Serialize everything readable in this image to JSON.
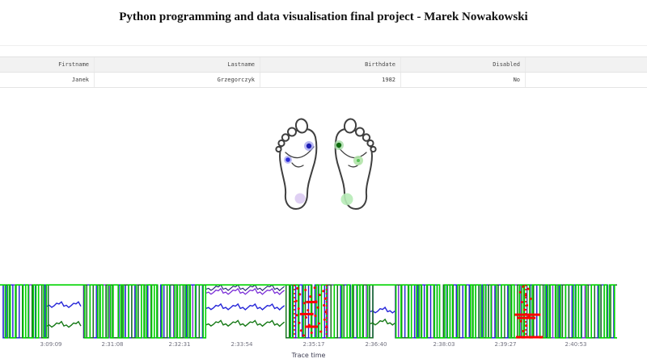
{
  "page": {
    "title": "Python programming and data visualisation final project - Marek Nowakowski"
  },
  "patient_table": {
    "columns": [
      {
        "label": "Firstname"
      },
      {
        "label": "Lastname"
      },
      {
        "label": "Birthdate"
      },
      {
        "label": "Disabled"
      }
    ],
    "rows": [
      {
        "firstname": "Janek",
        "lastname": "Grzegorczyk",
        "birthdate": "1982",
        "disabled": "No"
      }
    ]
  },
  "feet": {
    "sensors": [
      {
        "name": "left-ball-inner",
        "halo": "#9a9aec",
        "core": "#1c1cb4"
      },
      {
        "name": "left-ball-outer",
        "halo": "#9a9aec",
        "core": "#2d2dd9"
      },
      {
        "name": "left-heel",
        "halo": "#d9c8f1",
        "core": ""
      },
      {
        "name": "right-ball-inner",
        "halo": "#a6dba6",
        "core": "#0d6b0d"
      },
      {
        "name": "right-ball-outer",
        "halo": "#b2e4aa",
        "core": "#57c057"
      },
      {
        "name": "right-heel",
        "halo": "#b7ebb7",
        "core": ""
      }
    ]
  },
  "chart_data": {
    "type": "line",
    "title": "",
    "xlabel": "Trace time",
    "ylabel": "",
    "grid": false,
    "legend": "none",
    "y_range": [
      0,
      1
    ],
    "x_tick_labels": [
      "3:09:09",
      "2:31:08",
      "2:32:31",
      "2:33:54",
      "2:35:17",
      "2:36:40",
      "2:38:03",
      "2:39:27",
      "2:40:53"
    ],
    "x_tick_positions": [
      0.083,
      0.182,
      0.291,
      0.392,
      0.509,
      0.609,
      0.72,
      0.819,
      0.933
    ],
    "series": [
      {
        "name": "sensor-trace-navy",
        "color": "#1c1c6e",
        "width": 1.1,
        "bits": [
          "1000100100001001",
          "0000100100001001",
          "0010000100100001",
          "0000100100001001",
          "1000100100001001",
          "0010000100100001",
          "0000100100001001",
          "1000100100001001",
          "0000100100001001",
          "0010000100100001",
          "1000100100001001",
          "0000100100001001"
        ],
        "flat_top_ranges": [
          [
            0.076,
            0.131
          ],
          [
            0.334,
            0.461
          ],
          [
            0.6,
            0.64
          ]
        ],
        "analog": [
          {
            "x0": 0.334,
            "x1": 0.461,
            "y": 0.07
          }
        ]
      },
      {
        "name": "sensor-trace-violet",
        "color": "#7c2fd8",
        "width": 1.3,
        "bits": [
          "1001101001010011",
          "0100101001101001",
          "1010010100110100",
          "1001101001010011",
          "1010010100110100",
          "0100101001101001",
          "1001101001010011",
          "0100101001101001",
          "1010010100110100",
          "1001101001010011",
          "1010010100110100",
          "0100101001101001"
        ],
        "flat_top_ranges": [
          [
            0.076,
            0.131
          ],
          [
            0.334,
            0.461
          ],
          [
            0.6,
            0.64
          ]
        ],
        "analog": [
          {
            "x0": 0.334,
            "x1": 0.461,
            "y": 0.14
          }
        ]
      },
      {
        "name": "sensor-trace-blue",
        "color": "#2424d8",
        "width": 1.4,
        "bits": [
          "1011001100101100",
          "1100101100110010",
          "0110011001011010",
          "1010011001011001",
          "1100101100110010",
          "1011001100101100",
          "1010011001011001",
          "0110011001011010",
          "1011001100101100",
          "1100101100110010",
          "0110011001011010",
          "1010011001011001"
        ],
        "flat_top_ranges": [
          [
            0.076,
            0.131
          ],
          [
            0.334,
            0.461
          ],
          [
            0.6,
            0.64
          ]
        ],
        "analog": [
          {
            "x0": 0.076,
            "x1": 0.131,
            "y": 0.38
          },
          {
            "x0": 0.334,
            "x1": 0.461,
            "y": 0.42
          },
          {
            "x0": 0.6,
            "x1": 0.64,
            "y": 0.48
          }
        ]
      },
      {
        "name": "sensor-trace-darkgreen",
        "color": "#147814",
        "width": 1.4,
        "bits": [
          "1110011000111001",
          "1001100011100110",
          "0110001110011001",
          "1000111001100011",
          "1001100011100110",
          "1110011000111001",
          "1000111001100011",
          "0110001110011001",
          "1110011000111001",
          "1001100011100110",
          "0110001110011001",
          "1000111001100011"
        ],
        "flat_top_ranges": [
          [
            0.076,
            0.131
          ],
          [
            0.334,
            0.461
          ],
          [
            0.6,
            0.64
          ]
        ],
        "analog": [
          {
            "x0": 0.076,
            "x1": 0.131,
            "y": 0.74
          },
          {
            "x0": 0.334,
            "x1": 0.461,
            "y": 0.72
          },
          {
            "x0": 0.6,
            "x1": 0.64,
            "y": 0.7
          }
        ]
      },
      {
        "name": "sensor-trace-lime",
        "color": "#00d400",
        "width": 1.6,
        "bits": [
          "1101001110100101",
          "1011001110010110",
          "1001110100101101",
          "0011100101101001",
          "1100101101001110",
          "1101001110100101",
          "1001110100101101",
          "1011001110010110",
          "0011100101101001",
          "1100101101001110",
          "1101001110100101",
          "0011100101101001",
          "1001110100101101",
          "1100101101001110",
          "1011001110010110"
        ],
        "flat_top_ranges": [
          [
            0.076,
            0.131
          ],
          [
            0.334,
            0.461
          ],
          [
            0.6,
            0.64
          ]
        ]
      }
    ],
    "annotations": [
      {
        "name": "red-selection-box",
        "color": "#ff0000",
        "style": "dotted",
        "x0": 0.477,
        "x1": 0.529,
        "bars": [
          [
            0.33,
            0.496,
            0.514
          ],
          [
            0.55,
            0.486,
            0.508
          ],
          [
            0.78,
            0.494,
            0.515
          ]
        ],
        "dots": [
          [
            0.482,
            0.08
          ],
          [
            0.495,
            0.11
          ],
          [
            0.51,
            0.07
          ],
          [
            0.524,
            0.13
          ],
          [
            0.486,
            0.19
          ],
          [
            0.503,
            0.23
          ],
          [
            0.518,
            0.2
          ],
          [
            0.527,
            0.27
          ],
          [
            0.48,
            0.31
          ],
          [
            0.493,
            0.35
          ],
          [
            0.512,
            0.32
          ],
          [
            0.525,
            0.39
          ],
          [
            0.484,
            0.45
          ],
          [
            0.499,
            0.48
          ],
          [
            0.515,
            0.43
          ],
          [
            0.528,
            0.51
          ],
          [
            0.481,
            0.57
          ],
          [
            0.496,
            0.61
          ],
          [
            0.511,
            0.58
          ],
          [
            0.526,
            0.65
          ],
          [
            0.485,
            0.71
          ],
          [
            0.501,
            0.75
          ],
          [
            0.517,
            0.72
          ],
          [
            0.529,
            0.79
          ],
          [
            0.488,
            0.85
          ],
          [
            0.505,
            0.89
          ],
          [
            0.52,
            0.87
          ],
          [
            0.492,
            0.94
          ]
        ]
      },
      {
        "name": "red-selection-marker",
        "color": "#ff0000",
        "style": "dotted",
        "x": 0.852,
        "bars": [
          [
            0.56,
            0.834,
            0.876
          ],
          [
            0.62,
            0.838,
            0.868
          ],
          [
            0.97,
            0.836,
            0.88
          ]
        ],
        "dots": [
          [
            0.848,
            0.05
          ],
          [
            0.856,
            0.09
          ],
          [
            0.843,
            0.15
          ],
          [
            0.852,
            0.21
          ],
          [
            0.86,
            0.27
          ],
          [
            0.846,
            0.33
          ],
          [
            0.854,
            0.39
          ],
          [
            0.85,
            0.47
          ],
          [
            0.857,
            0.6
          ],
          [
            0.844,
            0.68
          ],
          [
            0.853,
            0.76
          ],
          [
            0.848,
            0.86
          ]
        ]
      }
    ]
  }
}
